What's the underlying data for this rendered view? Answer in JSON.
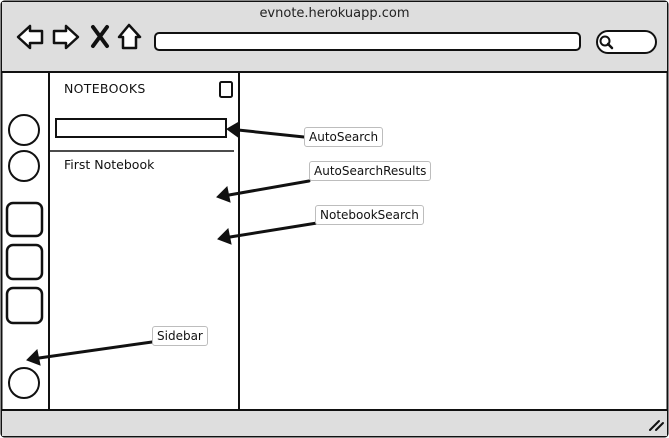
{
  "browser": {
    "url": "evnote.herokuapp.com",
    "icons": [
      "back-arrow-icon",
      "forward-arrow-icon",
      "close-x-icon",
      "home-icon",
      "search-icon"
    ]
  },
  "sidebar": {
    "icons": [
      "circle-icon",
      "circle-icon",
      "square-icon",
      "square-icon",
      "square-icon",
      "circle-icon"
    ]
  },
  "notebooks_panel": {
    "title": "NOTEBOOKS",
    "icon": "notebook-icon",
    "items": [
      "First Notebook"
    ]
  },
  "annotations": {
    "autosearch": "AutoSearch",
    "autosearch_results": "AutoSearchResults",
    "notebook_search": "NotebookSearch",
    "sidebar": "Sidebar"
  },
  "status_bar": {
    "icon": "resize-grip-icon"
  }
}
